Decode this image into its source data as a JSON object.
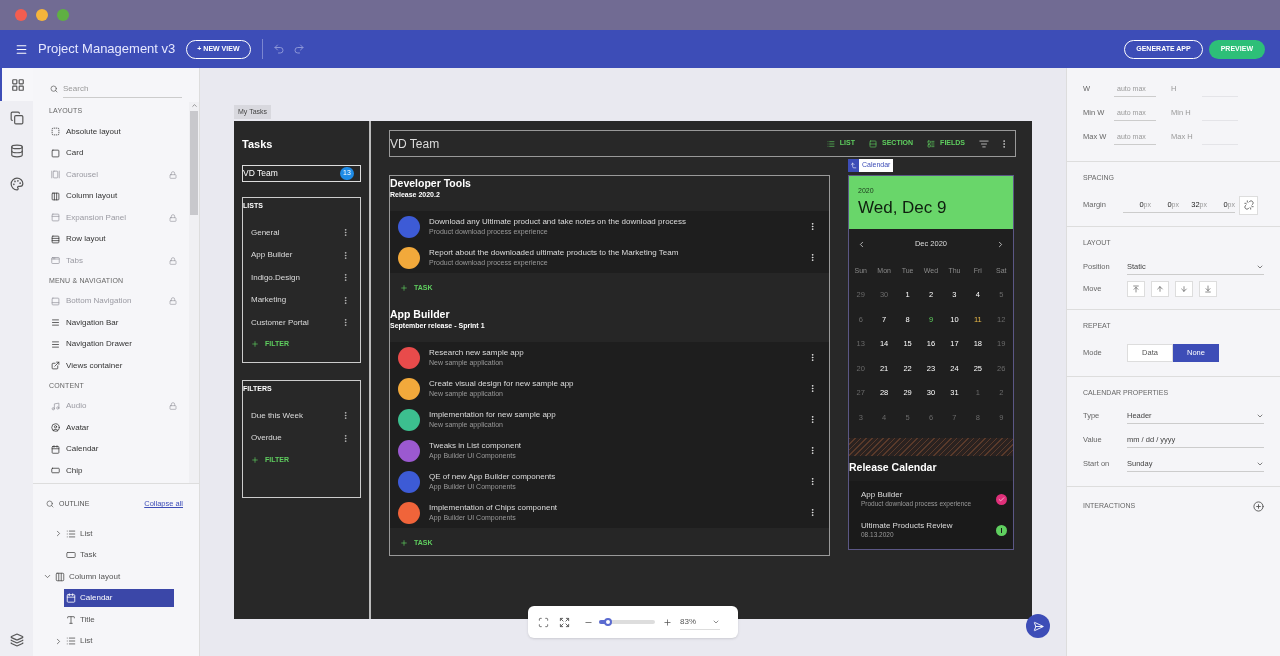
{
  "window_controls": [
    {
      "color": "#f35d50"
    },
    {
      "color": "#f5b53b"
    },
    {
      "color": "#5fb043"
    }
  ],
  "app_bar": {
    "title": "Project Management v3",
    "new_view_button": "+ NEW VIEW",
    "generate_button": "GENERATE APP",
    "preview_button": "PREVIEW"
  },
  "rail": [
    {
      "kind": "components",
      "selected": true
    },
    {
      "kind": "views",
      "selected": false
    },
    {
      "kind": "data",
      "selected": false
    },
    {
      "kind": "theme",
      "selected": false
    }
  ],
  "toolbox": {
    "search_placeholder": "Search",
    "groups": [
      {
        "title": "LAYOUTS",
        "items": [
          {
            "label": "Absolute layout",
            "kind": "absolute",
            "disabled": false
          },
          {
            "label": "Card",
            "kind": "card",
            "disabled": false
          },
          {
            "label": "Carousel",
            "kind": "carousel",
            "disabled": true
          },
          {
            "label": "Column layout",
            "kind": "column",
            "disabled": false
          },
          {
            "label": "Expansion Panel",
            "kind": "expansion",
            "disabled": true
          },
          {
            "label": "Row layout",
            "kind": "row",
            "disabled": false
          },
          {
            "label": "Tabs",
            "kind": "tabs",
            "disabled": true
          }
        ]
      },
      {
        "title": "MENU & NAVIGATION",
        "items": [
          {
            "label": "Bottom Navigation",
            "kind": "bottomnav",
            "disabled": true
          },
          {
            "label": "Navigation Bar",
            "kind": "navbar",
            "disabled": false
          },
          {
            "label": "Navigation Drawer",
            "kind": "drawer",
            "disabled": false
          },
          {
            "label": "Views container",
            "kind": "views",
            "disabled": false
          }
        ]
      },
      {
        "title": "CONTENT",
        "items": [
          {
            "label": "Audio",
            "kind": "audio",
            "disabled": true
          },
          {
            "label": "Avatar",
            "kind": "avatar",
            "disabled": false
          },
          {
            "label": "Calendar",
            "kind": "calendar",
            "disabled": false
          },
          {
            "label": "Chip",
            "kind": "chip",
            "disabled": false
          }
        ]
      }
    ]
  },
  "outline": {
    "title": "OUTLINE",
    "collapse_link": "Collapse all",
    "items": [
      {
        "children": [
          {
            "label": "List",
            "kind": "list",
            "expanded": false,
            "selected": false
          },
          {
            "label": "Task",
            "kind": "task",
            "selected": false
          }
        ]
      },
      {
        "label": "Column layout",
        "kind": "column",
        "expanded": true,
        "selected": false,
        "children": [
          {
            "label": "Calendar",
            "kind": "calendar",
            "selected": true
          },
          {
            "label": "Title",
            "kind": "title",
            "selected": false
          },
          {
            "label": "List",
            "kind": "list",
            "expanded": false,
            "selected": false
          }
        ]
      }
    ]
  },
  "canvas": {
    "tab": "My Tasks",
    "sidebar": {
      "title": "Tasks",
      "team": {
        "value": "VD Team",
        "badge": "13"
      },
      "cards": [
        {
          "title": "LISTS",
          "items": [
            "General",
            "App Builder",
            "Indigo.Design",
            "Marketing",
            "Customer Portal"
          ],
          "add_button": "FILTER"
        },
        {
          "title": "FILTERS",
          "items": [
            "Due this Week",
            "Overdue"
          ],
          "add_button": "FILTER"
        }
      ]
    },
    "header": {
      "title": "VD Team",
      "actions": [
        {
          "label": "LIST",
          "kind": "list"
        },
        {
          "label": "SECTION",
          "kind": "section"
        },
        {
          "label": "FIELDS",
          "kind": "fields"
        }
      ]
    },
    "sections": [
      {
        "title": "Developer Tools",
        "subtitle": "Release 2020.2",
        "add_button": "TASK",
        "tasks": [
          {
            "title": "Download any Ultimate product and take notes on the download process",
            "subtitle": "Product download process experience",
            "color": "#3d5bd6"
          },
          {
            "title": "Report about the downloaded ultimate products to the Marketing Team",
            "subtitle": "Product download process experience",
            "color": "#f2a93b"
          }
        ]
      },
      {
        "title": "App Builder",
        "subtitle": "September release - Sprint 1",
        "add_button": "TASK",
        "tasks": [
          {
            "title": "Research new sample app",
            "subtitle": "New sample application",
            "color": "#e84b4b"
          },
          {
            "title": "Create visual design for new sample app",
            "subtitle": "New sample application",
            "color": "#f2a93b"
          },
          {
            "title": "Implementation for new sample app",
            "subtitle": "New sample application",
            "color": "#3cbf8f"
          },
          {
            "title": "Tweaks in List component",
            "subtitle": "App Builder UI Components",
            "color": "#9b59d0"
          },
          {
            "title": "QE of new App Builder components",
            "subtitle": "App Builder UI Components",
            "color": "#3d5bd6"
          },
          {
            "title": "Implementation of Chips component",
            "subtitle": "App Builder UI Components",
            "color": "#f0643a"
          }
        ]
      }
    ],
    "calendar": {
      "tag": "Calendar",
      "year": "2020",
      "date": "Wed, Dec 9",
      "month": "Dec 2020",
      "weekdays": [
        "Sun",
        "Mon",
        "Tue",
        "Wed",
        "Thu",
        "Fri",
        "Sat"
      ],
      "weeks": [
        [
          {
            "label": "29",
            "kind": "muted"
          },
          {
            "label": "30",
            "kind": "muted"
          },
          {
            "label": "1",
            "kind": "day"
          },
          {
            "label": "2",
            "kind": "day"
          },
          {
            "label": "3",
            "kind": "day"
          },
          {
            "label": "4",
            "kind": "day"
          },
          {
            "label": "5",
            "kind": "muted"
          }
        ],
        [
          {
            "label": "6",
            "kind": "muted"
          },
          {
            "label": "7",
            "kind": "day"
          },
          {
            "label": "8",
            "kind": "day"
          },
          {
            "label": "9",
            "kind": "today"
          },
          {
            "label": "10",
            "kind": "day"
          },
          {
            "label": "11",
            "kind": "marked"
          },
          {
            "label": "12",
            "kind": "muted"
          }
        ],
        [
          {
            "label": "13",
            "kind": "muted"
          },
          {
            "label": "14",
            "kind": "day"
          },
          {
            "label": "15",
            "kind": "day"
          },
          {
            "label": "16",
            "kind": "day"
          },
          {
            "label": "17",
            "kind": "day"
          },
          {
            "label": "18",
            "kind": "day"
          },
          {
            "label": "19",
            "kind": "muted"
          }
        ],
        [
          {
            "label": "20",
            "kind": "muted"
          },
          {
            "label": "21",
            "kind": "day"
          },
          {
            "label": "22",
            "kind": "day"
          },
          {
            "label": "23",
            "kind": "day"
          },
          {
            "label": "24",
            "kind": "day"
          },
          {
            "label": "25",
            "kind": "day"
          },
          {
            "label": "26",
            "kind": "muted"
          }
        ],
        [
          {
            "label": "27",
            "kind": "muted"
          },
          {
            "label": "28",
            "kind": "day"
          },
          {
            "label": "29",
            "kind": "day"
          },
          {
            "label": "30",
            "kind": "day"
          },
          {
            "label": "31",
            "kind": "day"
          },
          {
            "label": "1",
            "kind": "muted"
          },
          {
            "label": "2",
            "kind": "muted"
          }
        ],
        [
          {
            "label": "3",
            "kind": "muted"
          },
          {
            "label": "4",
            "kind": "muted"
          },
          {
            "label": "5",
            "kind": "muted"
          },
          {
            "label": "6",
            "kind": "muted"
          },
          {
            "label": "7",
            "kind": "muted"
          },
          {
            "label": "8",
            "kind": "muted"
          },
          {
            "label": "9",
            "kind": "muted"
          }
        ]
      ]
    },
    "release": {
      "title": "Release Calendar",
      "items": [
        {
          "title": "App Builder",
          "subtitle": "Product download process experience",
          "kind": "done"
        },
        {
          "title": "Ultimate Products Review",
          "subtitle": "08.13.2020",
          "kind": "alert"
        }
      ]
    }
  },
  "zoom": {
    "level": 0.16,
    "value": "83%"
  },
  "properties": {
    "size_rows": [
      {
        "label": "W",
        "placeholder": "auto max",
        "second_label": "H"
      },
      {
        "label": "Min W",
        "placeholder": "auto max",
        "second_label": "Min H"
      },
      {
        "label": "Max W",
        "placeholder": "auto max",
        "second_label": "Max H"
      }
    ],
    "spacing": {
      "title": "SPACING",
      "label": "Margin",
      "fields": [
        {
          "value": "0",
          "unit": "px"
        },
        {
          "value": "0",
          "unit": "px"
        },
        {
          "value": "32",
          "unit": "px"
        },
        {
          "value": "0",
          "unit": "px"
        }
      ]
    },
    "layout": {
      "title": "LAYOUT",
      "position_label": "Position",
      "position": "Static",
      "move_label": "Move"
    },
    "repeat": {
      "title": "REPEAT",
      "mode_label": "Mode",
      "options": [
        {
          "label": "Data",
          "selected": false
        },
        {
          "label": "None",
          "selected": true
        }
      ]
    },
    "calendar_properties": {
      "title": "CALENDAR PROPERTIES",
      "rows": [
        {
          "label": "Type",
          "value": "Header",
          "kind": "select"
        },
        {
          "label": "Value",
          "placeholder": "mm / dd / yyyy",
          "kind": "input"
        },
        {
          "label": "Start on",
          "value": "Sunday",
          "kind": "select"
        }
      ]
    },
    "interactions": {
      "title": "INTERACTIONS"
    }
  }
}
